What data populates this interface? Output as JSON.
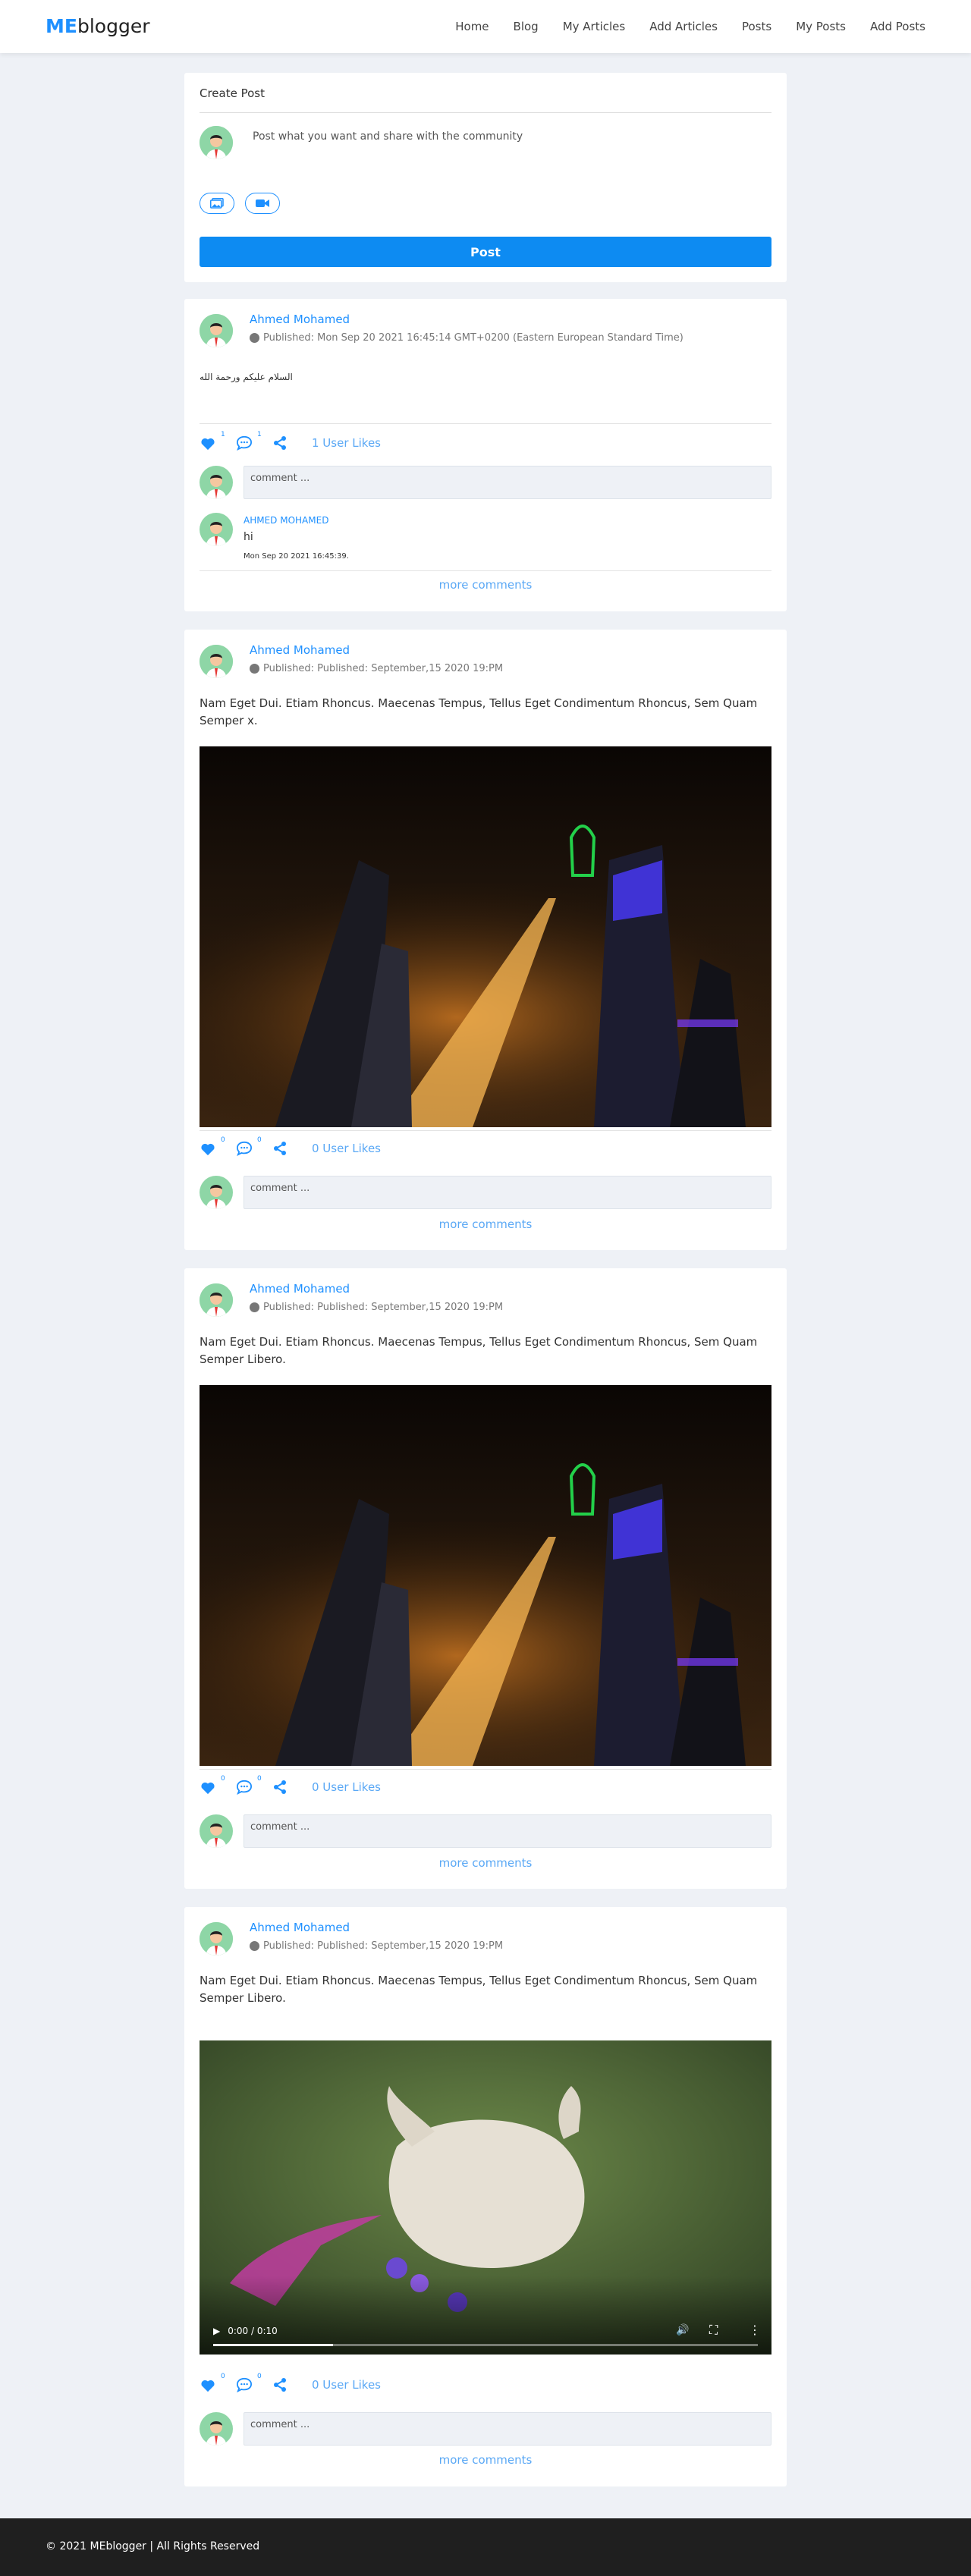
{
  "brand": {
    "prefix": "ME",
    "suffix": "blogger"
  },
  "nav": [
    "Home",
    "Blog",
    "My Articles",
    "Add Articles",
    "Posts",
    "My Posts",
    "Add Posts"
  ],
  "create_post": {
    "title": "Create Post",
    "placeholder": "Post what you want and share with the community",
    "image_icon": "image-icon",
    "video_icon": "video-icon",
    "button": "Post"
  },
  "posts": [
    {
      "author": "Ahmed Mohamed",
      "date": "Published: Mon Sep 20 2021 16:45:14 GMT+0200 (Eastern European Standard Time)",
      "text": "السلام عليكم ورحمة الله",
      "like_count": "1",
      "comment_count": "1",
      "likes": "1 User Likes",
      "comment_placeholder": "comment ...",
      "comment": {
        "name": "AHMED MOHAMED",
        "body": "hi",
        "date": "Mon Sep 20 2021 16:45:39."
      },
      "more": "more comments"
    },
    {
      "author": "Ahmed Mohamed",
      "date": "Published: Published: September,15 2020 19:PM",
      "text": "Nam Eget Dui. Etiam Rhoncus. Maecenas Tempus, Tellus Eget Condimentum Rhoncus, Sem Quam Semper x.",
      "like_count": "0",
      "comment_count": "0",
      "likes": "0 User Likes",
      "comment_placeholder": "comment ...",
      "more": "more comments"
    },
    {
      "author": "Ahmed Mohamed",
      "date": "Published: Published: September,15 2020 19:PM",
      "text": "Nam Eget Dui. Etiam Rhoncus. Maecenas Tempus, Tellus Eget Condimentum Rhoncus, Sem Quam Semper Libero.",
      "like_count": "0",
      "comment_count": "0",
      "likes": "0 User Likes",
      "comment_placeholder": "comment ...",
      "more": "more comments"
    },
    {
      "author": "Ahmed Mohamed",
      "date": "Published: Published: September,15 2020 19:PM",
      "text": "Nam Eget Dui. Etiam Rhoncus. Maecenas Tempus, Tellus Eget Condimentum Rhoncus, Sem Quam Semper Libero.",
      "like_count": "0",
      "comment_count": "0",
      "likes": "0 User Likes",
      "comment_placeholder": "comment ...",
      "video_time": "0:00 / 0:10",
      "more": "more comments"
    }
  ],
  "icons": {
    "like": "heart-icon",
    "comment": "comment-icon",
    "share": "share-icon",
    "globe": "globe-icon"
  },
  "footer": "© 2021 MEblogger | All Rights Reserved"
}
